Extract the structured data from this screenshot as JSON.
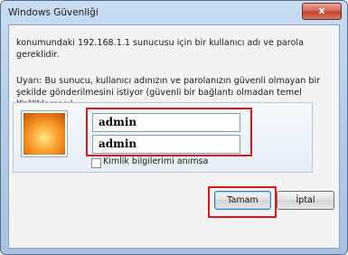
{
  "window": {
    "title": "Windows Güvenliği",
    "close_label": "x"
  },
  "message": {
    "line1": "konumundaki 192.168.1.1 sunucusu için bir kullanıcı adı ve parola",
    "line2": "gereklidir.",
    "warning1": "Uyarı: Bu sunucu, kullanıcı adınızın ve parolanızın güvenli olmayan bir",
    "warning2": "şekilde gönderilmesini istiyor (güvenli bir bağlantı olmadan temel kimlik",
    "warning3": "doğrulaması)."
  },
  "credentials": {
    "username_value": "admin",
    "password_value": "admin",
    "remember_label": "Kimlik bilgilerimi anımsa",
    "remember_checked": false
  },
  "buttons": {
    "ok_label": "Tamam",
    "cancel_label": "İptal"
  },
  "colors": {
    "highlight": "#e0141c",
    "close_button": "#c4442e"
  },
  "icons": {
    "user_tile": "user-tile-icon"
  }
}
